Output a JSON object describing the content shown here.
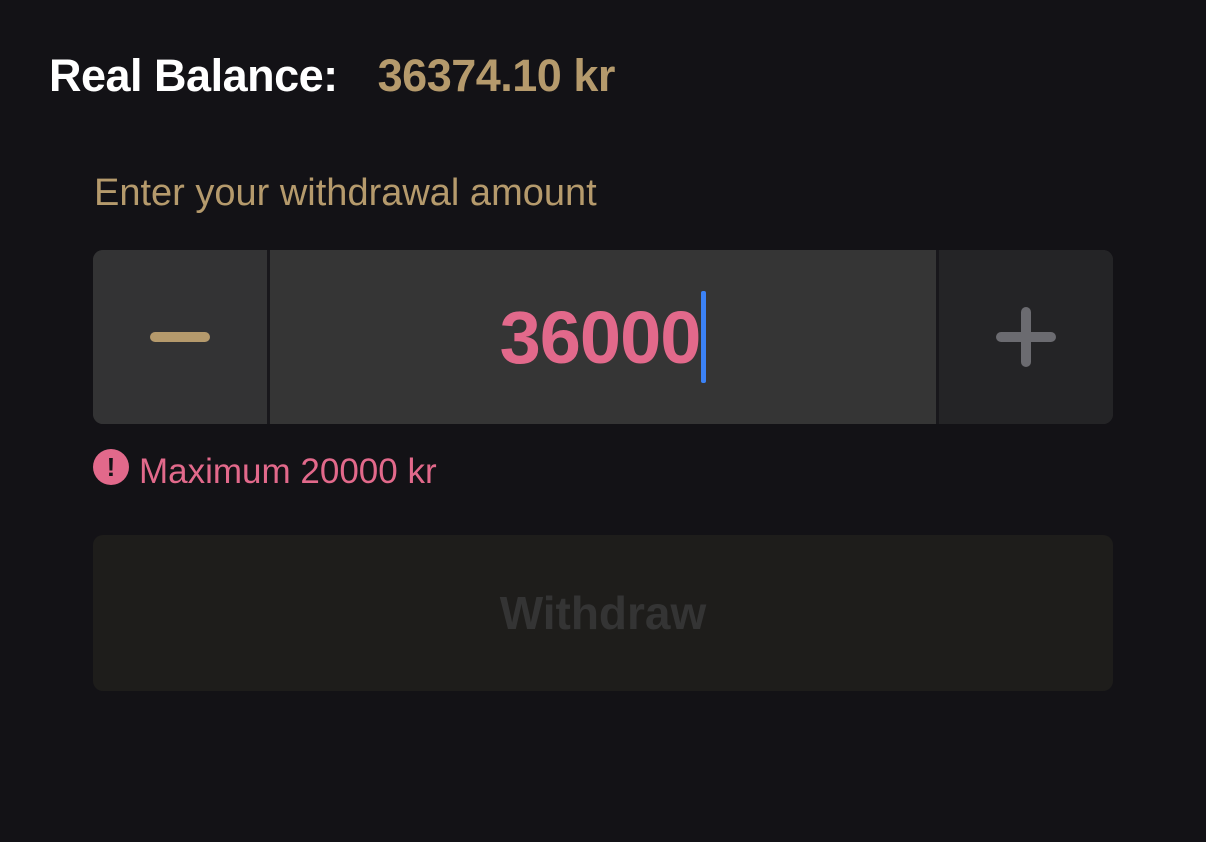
{
  "balance": {
    "label": "Real Balance:",
    "value": "36374.10 kr"
  },
  "withdrawal": {
    "label": "Enter your withdrawal amount",
    "amount_value": "36000",
    "decrement_icon": "minus-icon",
    "increment_icon": "plus-icon",
    "error_icon": "exclamation-circle-icon",
    "error_message": "Maximum 20000 kr",
    "submit_label": "Withdraw",
    "submit_disabled": true
  },
  "colors": {
    "background": "#131216",
    "accent_gold": "#b59a6c",
    "error_pink": "#e2698b",
    "caret_blue": "#3b82f6",
    "disabled_text": "#343434"
  }
}
